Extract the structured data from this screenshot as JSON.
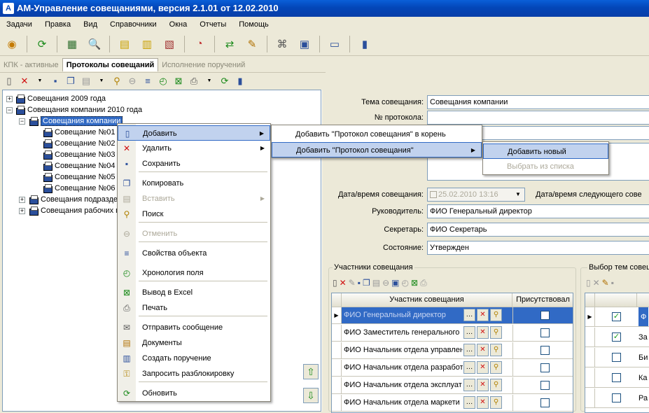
{
  "window": {
    "title": "АМ-Управление совещаниями, версия 2.1.01 от 12.02.2010"
  },
  "menu": [
    "Задачи",
    "Правка",
    "Вид",
    "Справочники",
    "Окна",
    "Отчеты",
    "Помощь"
  ],
  "tabs": [
    "КПК - активные",
    "Протоколы совещаний",
    "Исполнение поручений"
  ],
  "tree": {
    "nodes": [
      "Совещания 2009 года",
      "Совещания компании 2010 года",
      "Совещания компании",
      "Совещание №01",
      "Совещание №02",
      "Совещание №03",
      "Совещание №04",
      "Совещание №05",
      "Совещание №06",
      "Совещания подразде",
      "Совещания рабочих г"
    ]
  },
  "context_menu": {
    "items": [
      {
        "label": "Добавить",
        "icon": "page-icon"
      },
      {
        "label": "Удалить",
        "icon": "delete-icon"
      },
      {
        "label": "Сохранить",
        "icon": "save-icon"
      },
      {
        "label": "Копировать",
        "icon": "copy-icon"
      },
      {
        "label": "Вставить",
        "icon": "paste-icon"
      },
      {
        "label": "Поиск",
        "icon": "search-icon"
      },
      {
        "label": "Отменить",
        "icon": "undo-icon"
      },
      {
        "label": "Свойства объекта",
        "icon": "properties-icon"
      },
      {
        "label": "Хронология поля",
        "icon": "history-icon"
      },
      {
        "label": "Вывод в Excel",
        "icon": "excel-icon"
      },
      {
        "label": "Печать",
        "icon": "print-icon"
      },
      {
        "label": "Отправить сообщение",
        "icon": "mail-icon"
      },
      {
        "label": "Документы",
        "icon": "documents-icon"
      },
      {
        "label": "Создать поручение",
        "icon": "task-icon"
      },
      {
        "label": "Запросить разблокировку",
        "icon": "unlock-icon"
      },
      {
        "label": "Обновить",
        "icon": "refresh-icon"
      }
    ],
    "submenu1": [
      "Добавить \"Протокол совещания\" в корень",
      "Добавить \"Протокол совещания\""
    ],
    "submenu2": [
      "Добавить новый",
      "Выбрать из списка"
    ]
  },
  "form": {
    "topic_label": "Тема совещания:",
    "topic_value": "Совещания компании",
    "protocol_label": "№ протокола:",
    "protocol_value": "",
    "datetime_label": "Дата/время совещания:",
    "datetime_value": "25.02.2010 13:16",
    "next_datetime_label": "Дата/время следующего сове",
    "head_label": "Руководитель:",
    "head_value": "ФИО Генеральный директор",
    "secretary_label": "Секретарь:",
    "secretary_value": "ФИО Секретарь",
    "state_label": "Состояние:",
    "state_value": "Утвержден",
    "dropdown_arrow": "▼"
  },
  "participants": {
    "title": "Участники совещания",
    "col_participant": "Участник совещания",
    "col_present": "Присутствовал",
    "rows": [
      "ФИО Генеральный директор",
      "ФИО Заместитель генерального",
      "ФИО Начальник отдела управлен",
      "ФИО Начальник отдела разработ",
      "ФИО Начальник отдела эксплуат",
      "ФИО Начальник отдела маркети"
    ]
  },
  "topics": {
    "title": "Выбор тем совещ",
    "rows": [
      "Ф",
      "За",
      "Би",
      "Ка",
      "Ра"
    ],
    "checked": [
      true,
      true,
      false,
      false,
      false
    ]
  },
  "colors": {
    "title_bar": "#0346b8",
    "selection": "#316ac5",
    "menu_highlight": "#c1d2ee"
  }
}
